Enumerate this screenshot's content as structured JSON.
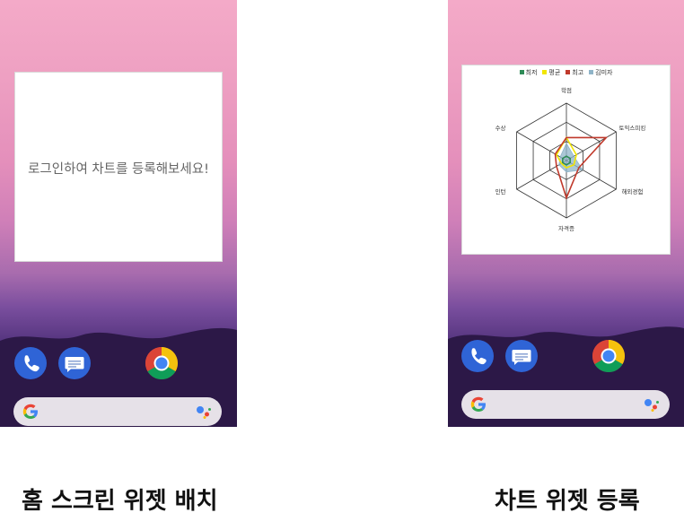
{
  "left_panel": {
    "widget_message": "로그인하여 차트를 등록해보세요!",
    "caption": "홈 스크린 위젯 배치"
  },
  "right_panel": {
    "caption": "차트 위젯 등록"
  },
  "dock_icons": [
    "phone-icon",
    "messages-icon",
    "chrome-icon"
  ],
  "search_icons": [
    "google-g-icon",
    "google-assistant-icon"
  ],
  "colors": {
    "wallpaper_top": "#f4aac8",
    "wallpaper_bottom": "#2a1747",
    "min_series": "#2e8b57",
    "avg_series": "#f2e600",
    "max_series": "#c0392b",
    "user_series": "#8fb4c8"
  },
  "chart_data": {
    "type": "radar",
    "axes": [
      "학점",
      "토익스피킹",
      "해외경험",
      "자격증",
      "인턴",
      "수상"
    ],
    "rmax": 4,
    "grid_levels": 3,
    "legend_position": "top",
    "series": [
      {
        "name": "최저",
        "color": "#2e8b57",
        "values": [
          0.3,
          0.3,
          0.3,
          0.3,
          0.3,
          0.3
        ]
      },
      {
        "name": "평균",
        "color": "#f2e600",
        "values": [
          1.6,
          0.8,
          0.6,
          0.5,
          0.4,
          0.8
        ]
      },
      {
        "name": "최고",
        "color": "#c0392b",
        "values": [
          1.6,
          3.2,
          1.0,
          2.6,
          0.8,
          0.9
        ]
      },
      {
        "name": "김미자",
        "color": "#8fb4c8",
        "values": [
          1.2,
          0.6,
          1.3,
          0.8,
          0.6,
          0.5
        ],
        "fill": true
      }
    ]
  }
}
